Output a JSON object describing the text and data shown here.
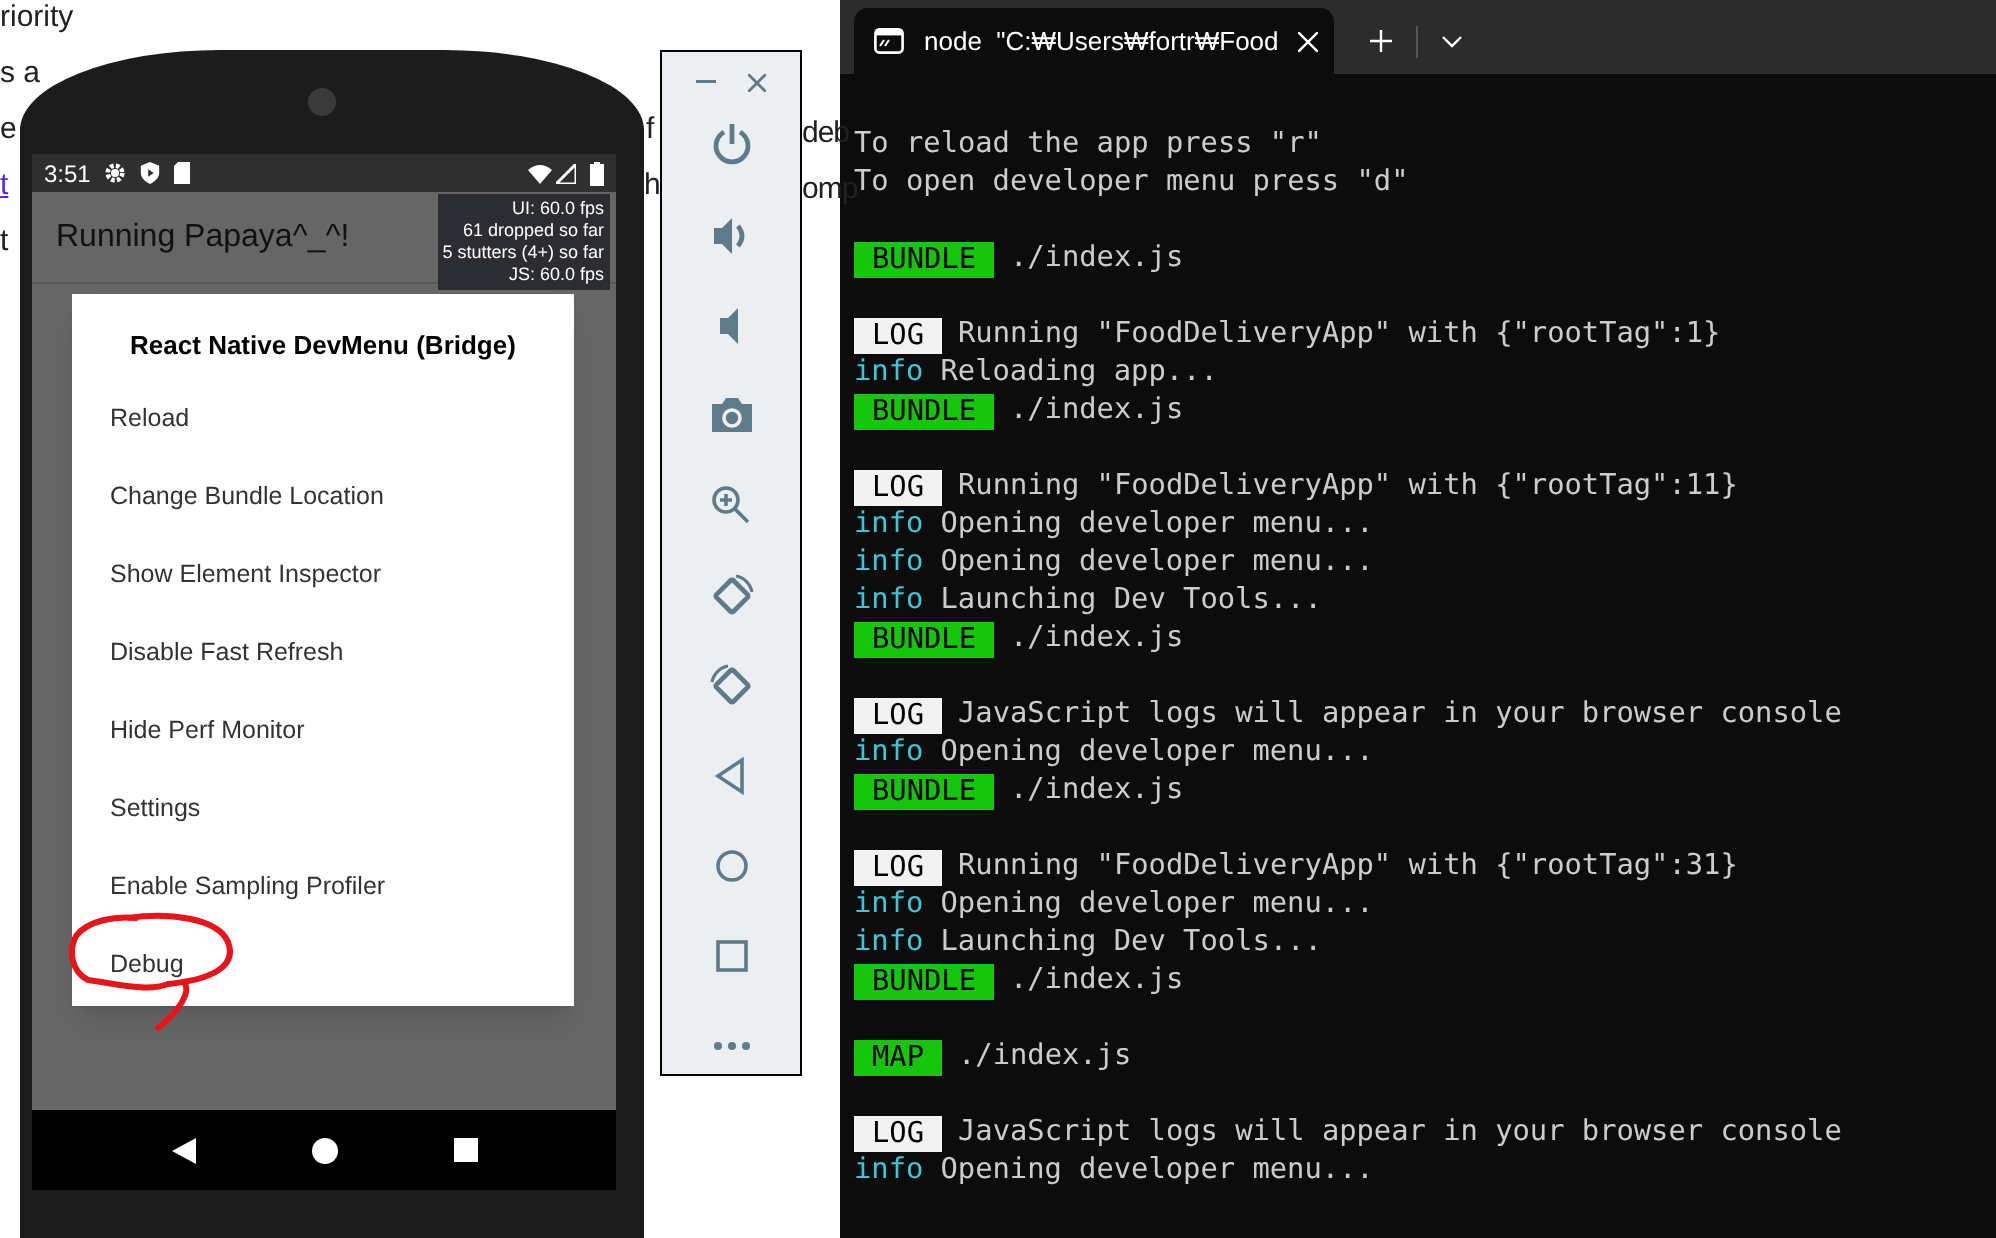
{
  "background_page": {
    "fragments": [
      {
        "text": "riority",
        "kind": "plain"
      },
      {
        "text": "s a",
        "kind": "plain"
      },
      {
        "text": "e",
        "kind": "plain"
      },
      {
        "text": "f",
        "kind": "plain"
      },
      {
        "text": "deb",
        "kind": "plain"
      },
      {
        "text": "t",
        "kind": "link"
      },
      {
        "text": "h",
        "kind": "plain"
      },
      {
        "text": "omp",
        "kind": "plain"
      },
      {
        "text": "t",
        "kind": "plain"
      }
    ]
  },
  "phone": {
    "status_bar": {
      "time": "3:51"
    },
    "app_title": "Running Papaya^_^!",
    "perf_monitor": [
      "UI: 60.0 fps",
      "61 dropped so far",
      "5 stutters (4+) so far",
      "JS: 60.0 fps"
    ],
    "dev_menu": {
      "title": "React Native DevMenu (Bridge)",
      "items": [
        {
          "label": "Reload",
          "circled": false
        },
        {
          "label": "Change Bundle Location",
          "circled": false
        },
        {
          "label": "Show Element Inspector",
          "circled": false
        },
        {
          "label": "Disable Fast Refresh",
          "circled": false
        },
        {
          "label": "Hide Perf Monitor",
          "circled": false
        },
        {
          "label": "Settings",
          "circled": false
        },
        {
          "label": "Enable Sampling Profiler",
          "circled": false
        },
        {
          "label": "Debug",
          "circled": true
        }
      ]
    }
  },
  "terminal": {
    "tab": {
      "title": "node  \"C:₩Users₩fortr₩Food",
      "selected": true
    },
    "lines": [
      {
        "kind": "text",
        "text": "To reload the app press \"r\""
      },
      {
        "kind": "text",
        "text": "To open developer menu press \"d\""
      },
      {
        "kind": "blank"
      },
      {
        "kind": "badge",
        "badge": "BUNDLE",
        "color": "#16c60c",
        "text": "./index.js"
      },
      {
        "kind": "blank"
      },
      {
        "kind": "badge",
        "badge": "LOG",
        "color": "#f2f2f2",
        "text": "Running \"FoodDeliveryApp\" with {\"rootTag\":1}"
      },
      {
        "kind": "info",
        "label": "info",
        "text": "Reloading app..."
      },
      {
        "kind": "badge",
        "badge": "BUNDLE",
        "color": "#16c60c",
        "text": "./index.js"
      },
      {
        "kind": "blank"
      },
      {
        "kind": "badge",
        "badge": "LOG",
        "color": "#f2f2f2",
        "text": "Running \"FoodDeliveryApp\" with {\"rootTag\":11}"
      },
      {
        "kind": "info",
        "label": "info",
        "text": "Opening developer menu..."
      },
      {
        "kind": "info",
        "label": "info",
        "text": "Opening developer menu..."
      },
      {
        "kind": "info",
        "label": "info",
        "text": "Launching Dev Tools..."
      },
      {
        "kind": "badge",
        "badge": "BUNDLE",
        "color": "#16c60c",
        "text": "./index.js"
      },
      {
        "kind": "blank"
      },
      {
        "kind": "badge",
        "badge": "LOG",
        "color": "#f2f2f2",
        "text": "JavaScript logs will appear in your browser console"
      },
      {
        "kind": "info",
        "label": "info",
        "text": "Opening developer menu..."
      },
      {
        "kind": "badge",
        "badge": "BUNDLE",
        "color": "#16c60c",
        "text": "./index.js"
      },
      {
        "kind": "blank"
      },
      {
        "kind": "badge",
        "badge": "LOG",
        "color": "#f2f2f2",
        "text": "Running \"FoodDeliveryApp\" with {\"rootTag\":31}"
      },
      {
        "kind": "info",
        "label": "info",
        "text": "Opening developer menu..."
      },
      {
        "kind": "info",
        "label": "info",
        "text": "Launching Dev Tools..."
      },
      {
        "kind": "badge",
        "badge": "BUNDLE",
        "color": "#16c60c",
        "text": "./index.js"
      },
      {
        "kind": "blank"
      },
      {
        "kind": "badge",
        "badge": "MAP",
        "color": "#16c60c",
        "text": "./index.js"
      },
      {
        "kind": "blank"
      },
      {
        "kind": "badge",
        "badge": "LOG",
        "color": "#f2f2f2",
        "text": "JavaScript logs will appear in your browser console"
      },
      {
        "kind": "info",
        "label": "info",
        "text": "Opening developer menu..."
      }
    ]
  }
}
